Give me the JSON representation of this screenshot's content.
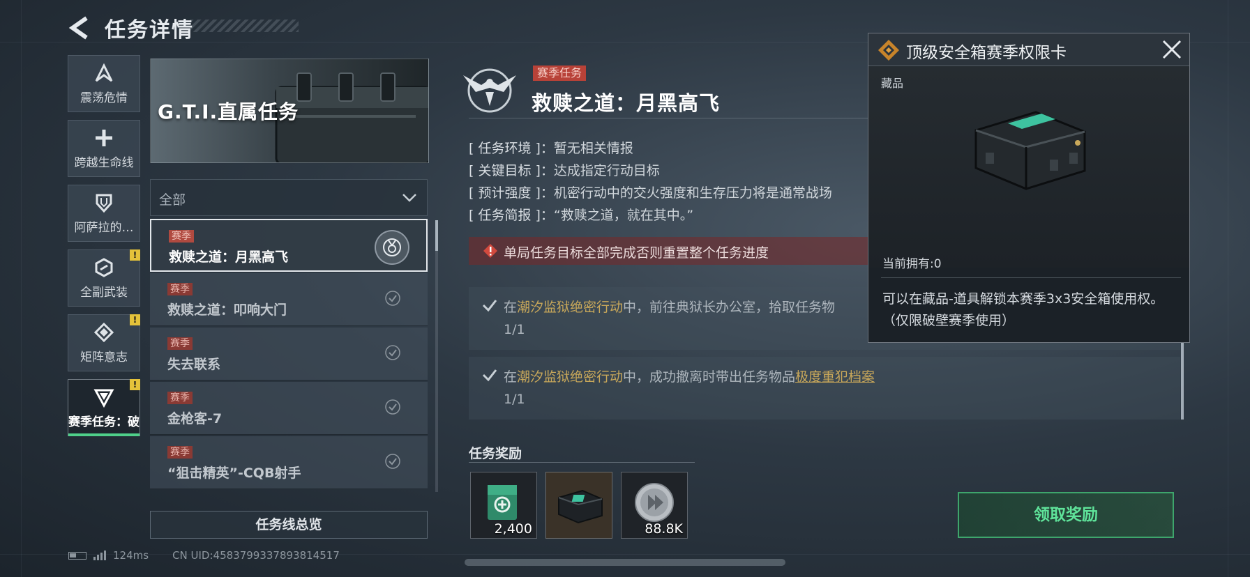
{
  "header": {
    "title": "任务详情"
  },
  "categories": [
    {
      "label": "震荡危情",
      "icon": "arrow-a-icon",
      "warning": false,
      "active": false
    },
    {
      "label": "跨越生命线",
      "icon": "cross-icon",
      "warning": false,
      "active": false
    },
    {
      "label": "阿萨拉的…",
      "icon": "shield-icon",
      "warning": false,
      "active": false
    },
    {
      "label": "全副武装",
      "icon": "armor-icon",
      "warning": true,
      "active": false
    },
    {
      "label": "矩阵意志",
      "icon": "matrix-icon",
      "warning": true,
      "active": false
    },
    {
      "label": "赛季任务：破",
      "icon": "triangle-icon",
      "warning": true,
      "active": true
    }
  ],
  "warning_mark": "!",
  "banner": {
    "title": "G.T.I.直属任务"
  },
  "filter": {
    "label": "全部"
  },
  "tasks": [
    {
      "tag": "赛季",
      "name": "救赎之道：月黑高飞",
      "selected": true
    },
    {
      "tag": "赛季",
      "name": "救赎之道：叩响大门",
      "selected": false
    },
    {
      "tag": "赛季",
      "name": "失去联系",
      "selected": false
    },
    {
      "tag": "赛季",
      "name": "金枪客-7",
      "selected": false
    },
    {
      "tag": "赛季",
      "name": "“狙击精英”-CQB射手",
      "selected": false
    }
  ],
  "overview_button": "任务线总览",
  "status": {
    "ping": "124ms",
    "uid": "CN UID:4583799337893814517"
  },
  "detail": {
    "tag": "赛季任务",
    "title": "救赎之道：月黑高飞",
    "info": [
      {
        "key": "[ 任务环境 ]：",
        "value": "暂无相关情报"
      },
      {
        "key": "[ 关键目标 ]：",
        "value": "达成指定行动目标"
      },
      {
        "key": "[ 预计强度 ]：",
        "value": "机密行动中的交火强度和生存压力将是通常战场"
      },
      {
        "key": "[ 任务简报 ]：",
        "value": "“救赎之道，就在其中。”"
      }
    ],
    "warning": "单局任务目标全部完成否则重置整个任务进度",
    "objectives": [
      {
        "pre": "在",
        "location": "潮汐监狱绝密行动",
        "mid": "中，前往典狱长办公室，拾取任务物",
        "link": "",
        "progress": "1/1"
      },
      {
        "pre": "在",
        "location": "潮汐监狱绝密行动",
        "mid": "中，成功撤离时带出任务物品",
        "link": "极度重犯档案",
        "progress": "1/1"
      }
    ]
  },
  "rewards": {
    "title": "任务奖励",
    "items": [
      {
        "qty": "2,400",
        "icon": "medkit-icon"
      },
      {
        "qty": "",
        "icon": "safe-box-icon"
      },
      {
        "qty": "88.8K",
        "icon": "coin-icon"
      }
    ],
    "claim_label": "领取奖励"
  },
  "popup": {
    "title": "顶级安全箱赛季权限卡",
    "category": "藏品",
    "owned": "当前拥有:0",
    "description": "可以在藏品-道具解锁本赛季3x3安全箱使用权。（仅限破壁赛季使用）"
  },
  "colors": {
    "accent_green": "#4fd08a",
    "season_red": "#b84238",
    "highlight_gold": "#c9a85a",
    "warning_yellow": "#e4c23a"
  }
}
